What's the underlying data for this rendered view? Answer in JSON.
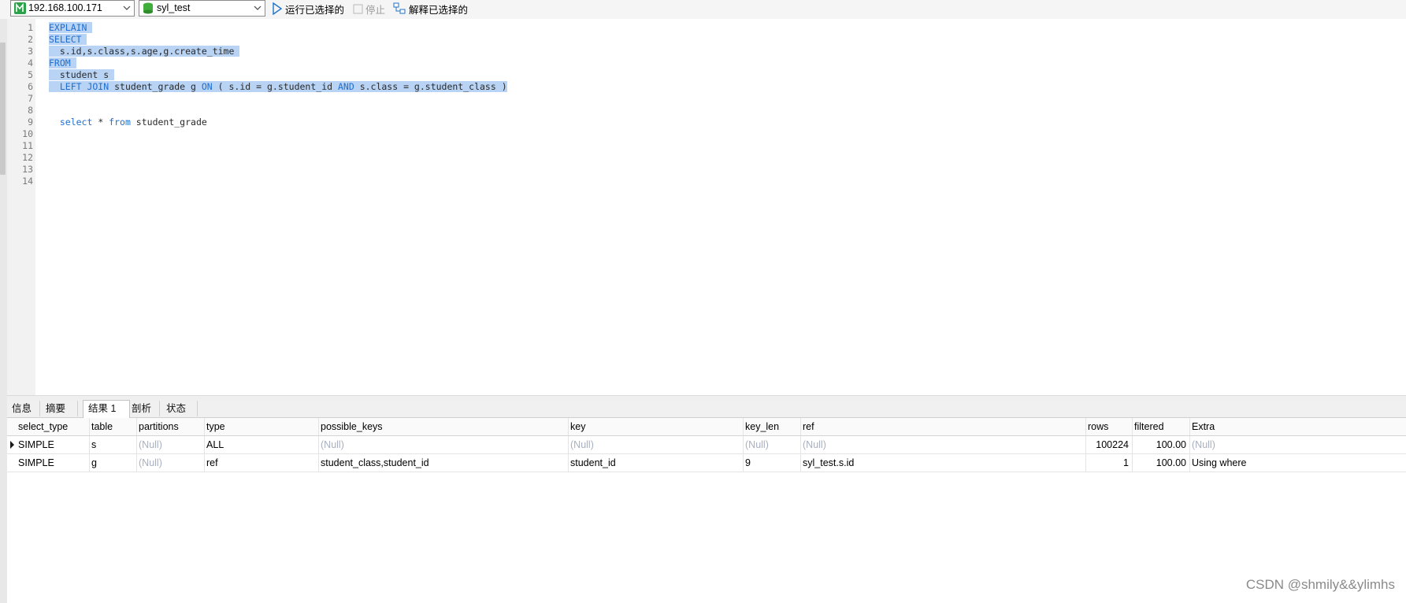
{
  "toolbar": {
    "connection": "192.168.100.171",
    "database": "syl_test",
    "run_selected": "运行已选择的",
    "stop": "停止",
    "explain_selected": "解释已选择的"
  },
  "editor": {
    "line_numbers": [
      "1",
      "2",
      "3",
      "4",
      "5",
      "6",
      "7",
      "8",
      "9",
      "10",
      "11",
      "12",
      "13",
      "14"
    ],
    "lines": {
      "l1": "EXPLAIN",
      "l2": "SELECT",
      "l3": "  s.id,s.class,s.age,g.create_time",
      "l4": "FROM",
      "l5": "  student s",
      "l6_kw1": "  LEFT JOIN",
      "l6_a": " student_grade g ",
      "l6_kw2": "ON",
      "l6_b": " ( s.id = g.student_id ",
      "l6_kw3": "AND",
      "l6_c": " s.class = g.student_class )",
      "l9_kw1": "  select",
      "l9_a": " * ",
      "l9_kw2": "from",
      "l9_b": " student_grade"
    },
    "selection_color": "#b8d3f3",
    "keyword_color": "#1f6fd1"
  },
  "tabs": [
    "信息",
    "摘要",
    "结果 1",
    "剖析",
    "状态"
  ],
  "active_tab": "结果 1",
  "result": {
    "columns": [
      "select_type",
      "table",
      "partitions",
      "type",
      "possible_keys",
      "key",
      "key_len",
      "ref",
      "rows",
      "filtered",
      "Extra"
    ],
    "rows": [
      [
        "SIMPLE",
        "s",
        "(Null)",
        "ALL",
        "(Null)",
        "(Null)",
        "(Null)",
        "(Null)",
        "100224",
        "100.00",
        "(Null)"
      ],
      [
        "SIMPLE",
        "g",
        "(Null)",
        "ref",
        "student_class,student_id",
        "student_id",
        "9",
        "syl_test.s.id",
        "1",
        "100.00",
        "Using where"
      ]
    ]
  },
  "watermark": "CSDN @shmily&&ylimhs"
}
